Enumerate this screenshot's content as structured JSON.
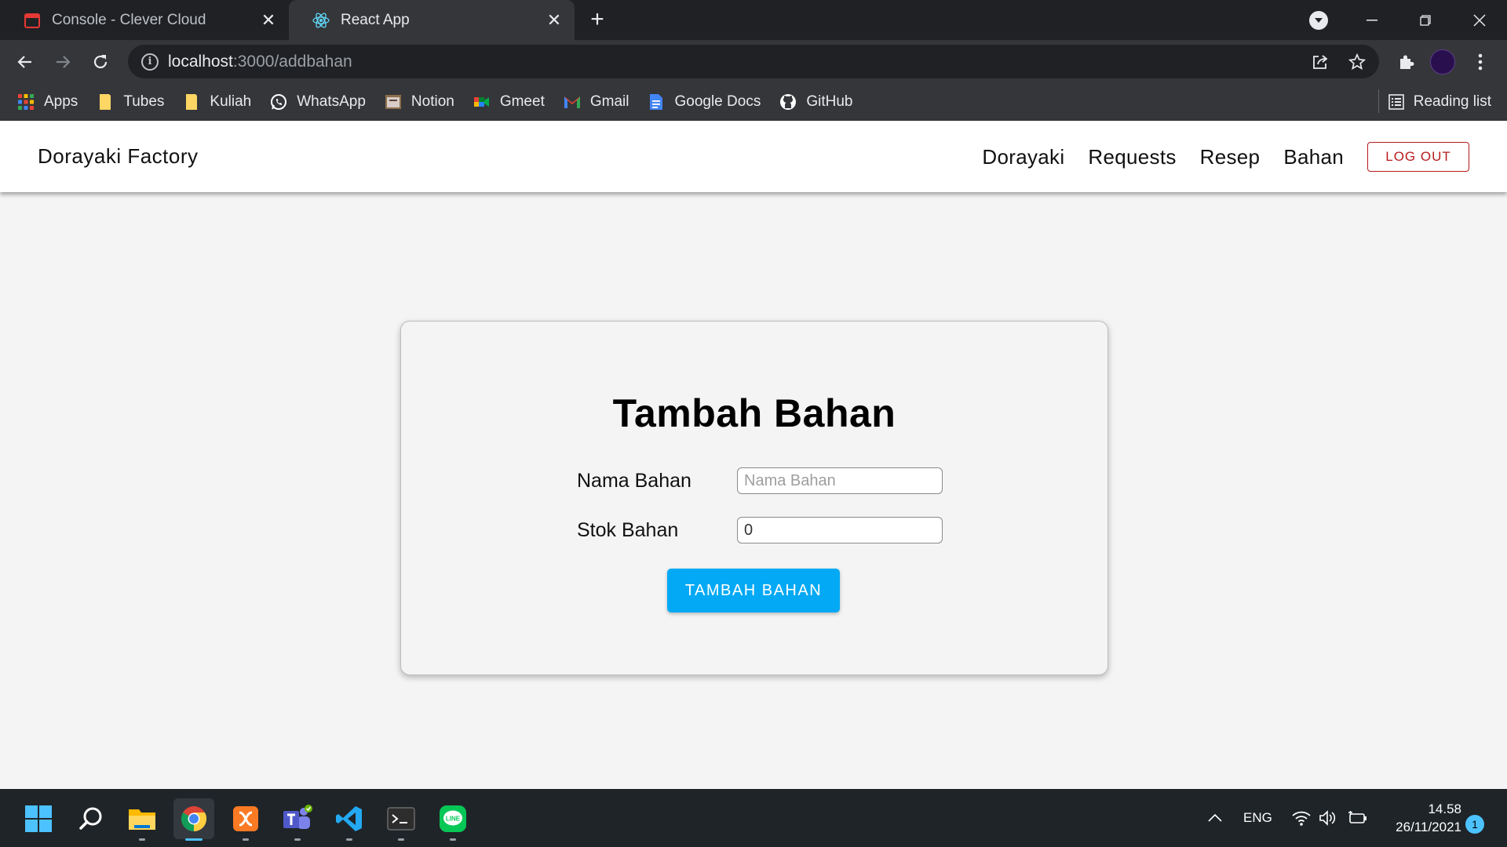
{
  "browser": {
    "tabs": [
      {
        "title": "Console - Clever Cloud",
        "icon": "calendar-icon"
      },
      {
        "title": "React App",
        "icon": "react-icon"
      }
    ],
    "url": {
      "host": "localhost",
      "path": ":3000/addbahan"
    },
    "bookmarks": [
      {
        "label": "Apps",
        "icon": "apps-grid-icon"
      },
      {
        "label": "Tubes",
        "icon": "folder-icon"
      },
      {
        "label": "Kuliah",
        "icon": "folder-icon"
      },
      {
        "label": "WhatsApp",
        "icon": "whatsapp-icon"
      },
      {
        "label": "Notion",
        "icon": "notion-icon"
      },
      {
        "label": "Gmeet",
        "icon": "gmeet-icon"
      },
      {
        "label": "Gmail",
        "icon": "gmail-icon"
      },
      {
        "label": "Google Docs",
        "icon": "google-docs-icon"
      },
      {
        "label": "GitHub",
        "icon": "github-icon"
      }
    ],
    "reading_list": "Reading list"
  },
  "app": {
    "brand": "Dorayaki Factory",
    "nav": [
      "Dorayaki",
      "Requests",
      "Resep",
      "Bahan"
    ],
    "logout": "LOG OUT",
    "form": {
      "title": "Tambah Bahan",
      "name_label": "Nama Bahan",
      "name_placeholder": "Nama Bahan",
      "stock_label": "Stok Bahan",
      "stock_value": "0",
      "submit": "TAMBAH BAHAN"
    }
  },
  "taskbar": {
    "apps": [
      "start-icon",
      "search-icon",
      "file-explorer-icon",
      "chrome-icon",
      "xampp-icon",
      "teams-icon",
      "vscode-icon",
      "terminal-icon",
      "line-icon"
    ],
    "language": "ENG",
    "time": "14.58",
    "date": "26/11/2021",
    "notifications": "1"
  },
  "colors": {
    "accent": "#03a9f4",
    "logout": "#b71c1c",
    "chrome_dark": "#202124",
    "chrome_toolbar": "#35363a"
  }
}
